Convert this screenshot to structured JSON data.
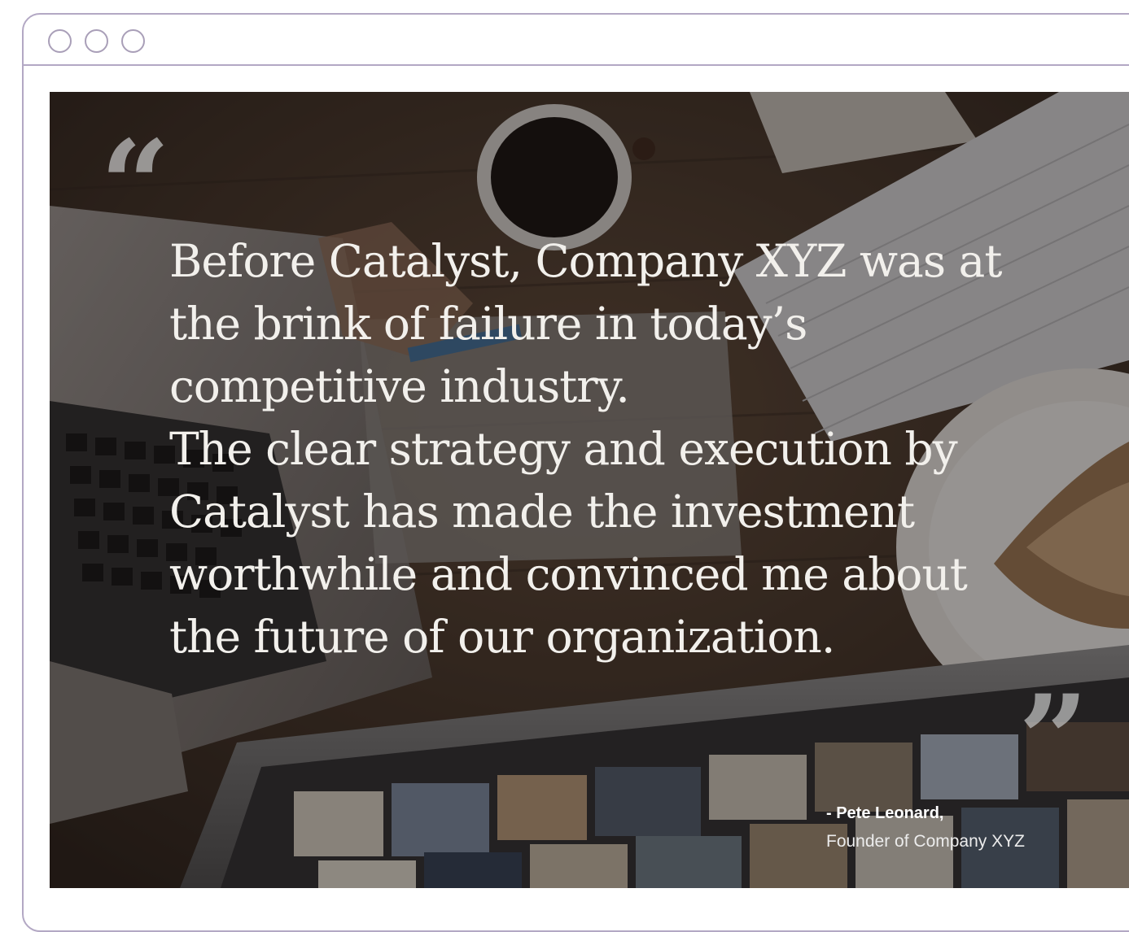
{
  "window": {
    "traffic_lights": [
      "circle",
      "circle",
      "circle"
    ],
    "frame_color": "#b3a8c4"
  },
  "testimonial": {
    "open_quote": "“",
    "close_quote": "”",
    "lines": [
      "Before Catalyst, Company XYZ was at",
      "the brink of failure in today’s",
      "competitive industry.",
      "The clear strategy and execution by",
      "Catalyst has made the investment",
      "worthwhile and convinced me about",
      "the future of our organization."
    ],
    "author": "- Pete Leonard,",
    "author_role": "Founder of Company XYZ",
    "text_color": "#f2f0ec",
    "quote_mark_color": "#bebebe"
  },
  "background": {
    "description_icons": [
      "laptop-icon",
      "coffee-cup-icon",
      "keyboard-icon",
      "plate-icon",
      "monitor-icon"
    ]
  }
}
